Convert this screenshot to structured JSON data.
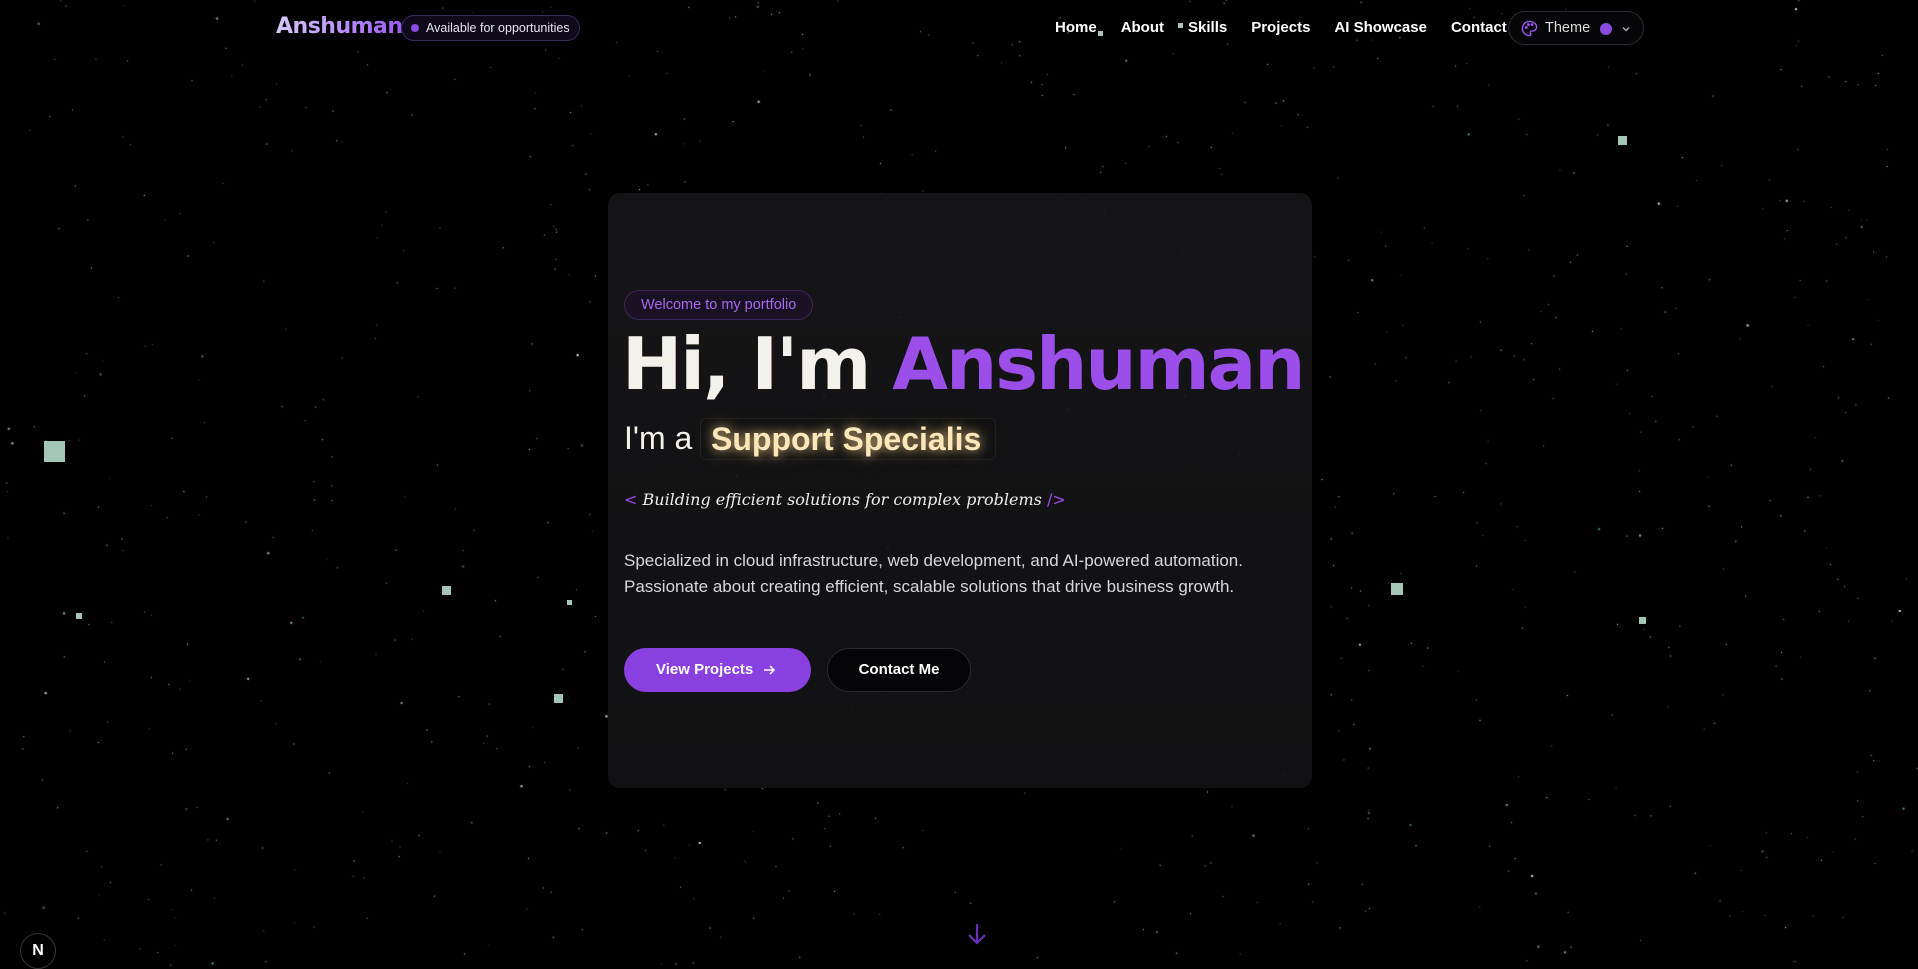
{
  "brand": {
    "logo_text": "Anshuman",
    "status_badge": "Available for opportunities"
  },
  "nav": {
    "links": [
      "Home",
      "About",
      "Skills",
      "Projects",
      "AI Showcase",
      "Contact"
    ]
  },
  "theme_picker": {
    "label": "Theme",
    "current_color": "#8b4ae0",
    "icon": "palette-icon"
  },
  "hero": {
    "welcome_badge": "Welcome to my portfolio",
    "greeting": "Hi, I'm ",
    "name": "Anshuman",
    "role_prefix": "I'm a",
    "role_typed": "Support Specialis",
    "tagline_open": "<",
    "tagline": "Building efficient solutions for complex problems",
    "tagline_close": "/>",
    "description": "Specialized in cloud infrastructure, web development, and AI-powered automation. Passionate about creating efficient, scalable solutions that drive business growth.",
    "primary_button": "View Projects",
    "secondary_button": "Contact Me"
  },
  "corner_badge": "N",
  "colors": {
    "accent": "#8b4ae0",
    "background": "#000000",
    "role_glow": "#fde7b8"
  }
}
